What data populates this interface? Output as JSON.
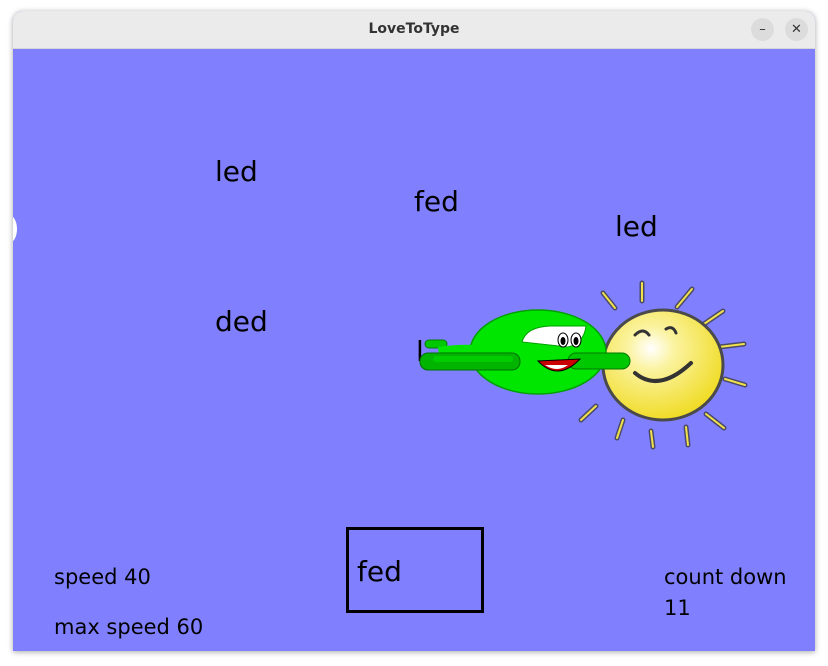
{
  "window": {
    "title": "LoveToType",
    "minimize_label": "–",
    "close_label": "✕"
  },
  "game": {
    "background_color": "#8080ff",
    "words": [
      "led",
      "fed",
      "led",
      "ded",
      "l"
    ],
    "typed_text": "fed",
    "speed_label": "speed 40",
    "max_speed_label": "max speed 60",
    "countdown_label": "count down",
    "countdown_value": "11",
    "sprites": [
      "airplane",
      "sun"
    ]
  }
}
